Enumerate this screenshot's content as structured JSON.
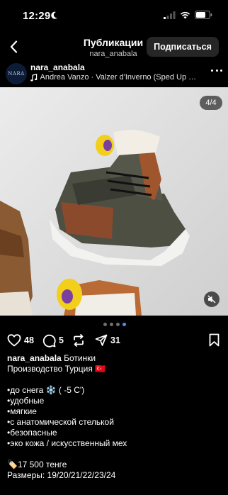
{
  "status_bar": {
    "time": "12:29"
  },
  "header": {
    "title": "Публикации",
    "subtitle": "nara_anabala",
    "follow_label": "Подписаться"
  },
  "post": {
    "avatar_text": "NARA",
    "username": "nara_anabala",
    "music": "Andrea Vanzo · Valzer d'Inverno (Sped Up & R...",
    "counter": "4/4",
    "carousel": {
      "total": 4,
      "active": 4
    },
    "likes": "48",
    "comments": "5",
    "shares": "31",
    "caption": {
      "username": "nara_anabala",
      "title": "Ботинки",
      "origin": "Производство Турция 🇹🇷",
      "features": [
        "•до снега ❄️ ( -5 С')",
        "•удобные",
        "•мягкие",
        "•с анатомической стелькой",
        "•безопасные",
        "•эко кожа / искусственный мех"
      ],
      "price": "🏷️17 500 тенге",
      "sizes": "Размеры: 19/20/21/22/23/24"
    }
  },
  "colors": {
    "background": "#000000",
    "button_bg": "#262626",
    "dot_active": "#4f8ef7"
  }
}
